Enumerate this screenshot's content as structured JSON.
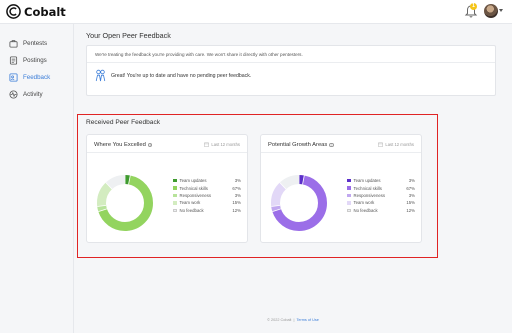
{
  "app": {
    "name": "Cobalt",
    "notification_count": "1"
  },
  "sidebar": {
    "items": [
      {
        "label": "Pentests",
        "icon": "briefcase-icon",
        "active": false
      },
      {
        "label": "Postings",
        "icon": "list-icon",
        "active": false
      },
      {
        "label": "Feedback",
        "icon": "feedback-icon",
        "active": true
      },
      {
        "label": "Activity",
        "icon": "pulse-icon",
        "active": false
      }
    ]
  },
  "open_feedback": {
    "title": "Your Open Peer Feedback",
    "description": "We're treating the feedback you're providing with care. We won't share it directly with other pentesters.",
    "message": "Great! You're up to date and have no pending peer feedback."
  },
  "received": {
    "title": "Received Peer Feedback"
  },
  "colors": {
    "accent": "#3b7dd8",
    "highlight_border": "#e02424"
  },
  "chart_data": [
    {
      "type": "pie",
      "title": "Where You Excelled",
      "period": "Last 12 months",
      "categories": [
        "Team updates",
        "Technical skills",
        "Responsiveness",
        "Team work",
        "No feedback"
      ],
      "values": [
        3,
        67,
        3,
        15,
        12
      ],
      "value_labels": [
        "3%",
        "67%",
        "3%",
        "15%",
        "12%"
      ],
      "colors": [
        "#3f9b2f",
        "#93d45f",
        "#b7e39a",
        "#d3ecc0",
        "#eef0f2"
      ]
    },
    {
      "type": "pie",
      "title": "Potential Growth Areas",
      "period": "Last 12 months",
      "categories": [
        "Team updates",
        "Technical skills",
        "Responsiveness",
        "Team work",
        "No feedback"
      ],
      "values": [
        3,
        67,
        3,
        15,
        12
      ],
      "value_labels": [
        "3%",
        "67%",
        "3%",
        "15%",
        "12%"
      ],
      "colors": [
        "#5b2fc9",
        "#9b6ee8",
        "#c1a8f0",
        "#e2d8f7",
        "#eef0f2"
      ]
    }
  ],
  "footer": {
    "copyright": "© 2022 Cobalt",
    "terms": "Terms of Use"
  }
}
